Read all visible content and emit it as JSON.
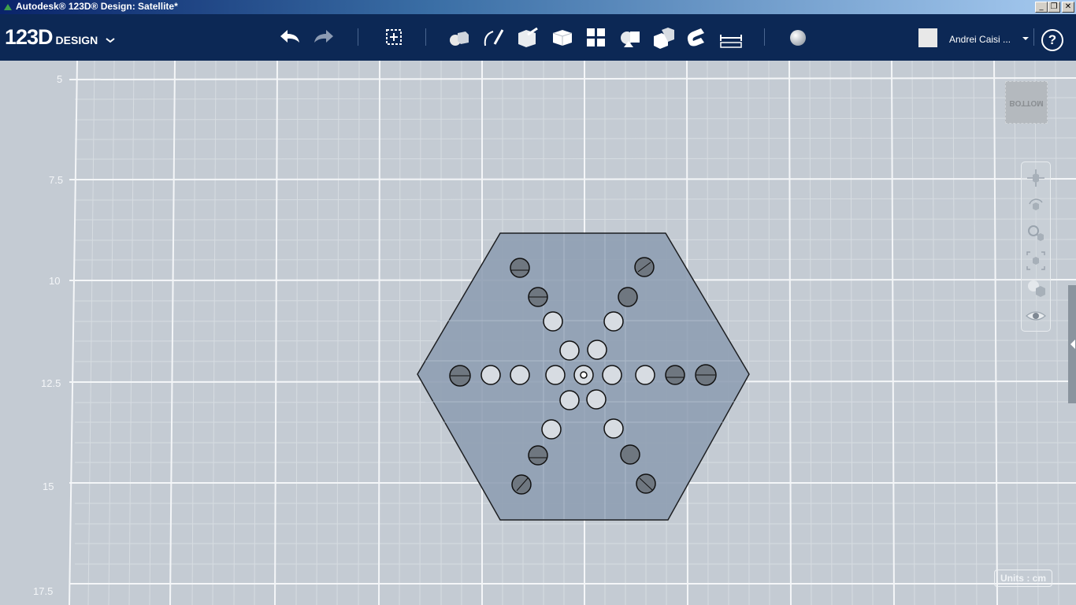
{
  "window": {
    "title": "Autodesk® 123D® Design: Satellite*",
    "controls": [
      "_",
      "❐",
      "✕"
    ]
  },
  "toolbar": {
    "logo_number": "123D",
    "logo_word": "DESIGN",
    "logo_menu_icon": "chevron-down-icon",
    "tools": [
      "undo-icon",
      "redo-icon",
      "transform-icon",
      "primitives-icon",
      "sketch-icon",
      "construct-icon",
      "modify-icon",
      "pattern-icon",
      "grouping-icon",
      "combine-icon",
      "snap-icon",
      "measure-icon",
      "material-icon"
    ],
    "user_name": "Andrei Caisi ...",
    "help_label": "?"
  },
  "viewport": {
    "y_labels": [
      "5",
      "7.5",
      "10",
      "12.5",
      "15",
      "17.5"
    ],
    "viewcube_label": "BOTTOM",
    "units_label": "Units : cm",
    "nav_tools": [
      "pan-icon",
      "orbit-icon",
      "zoom-icon",
      "fit-icon",
      "materials-outlines-icon",
      "visibility-eye-icon"
    ]
  }
}
